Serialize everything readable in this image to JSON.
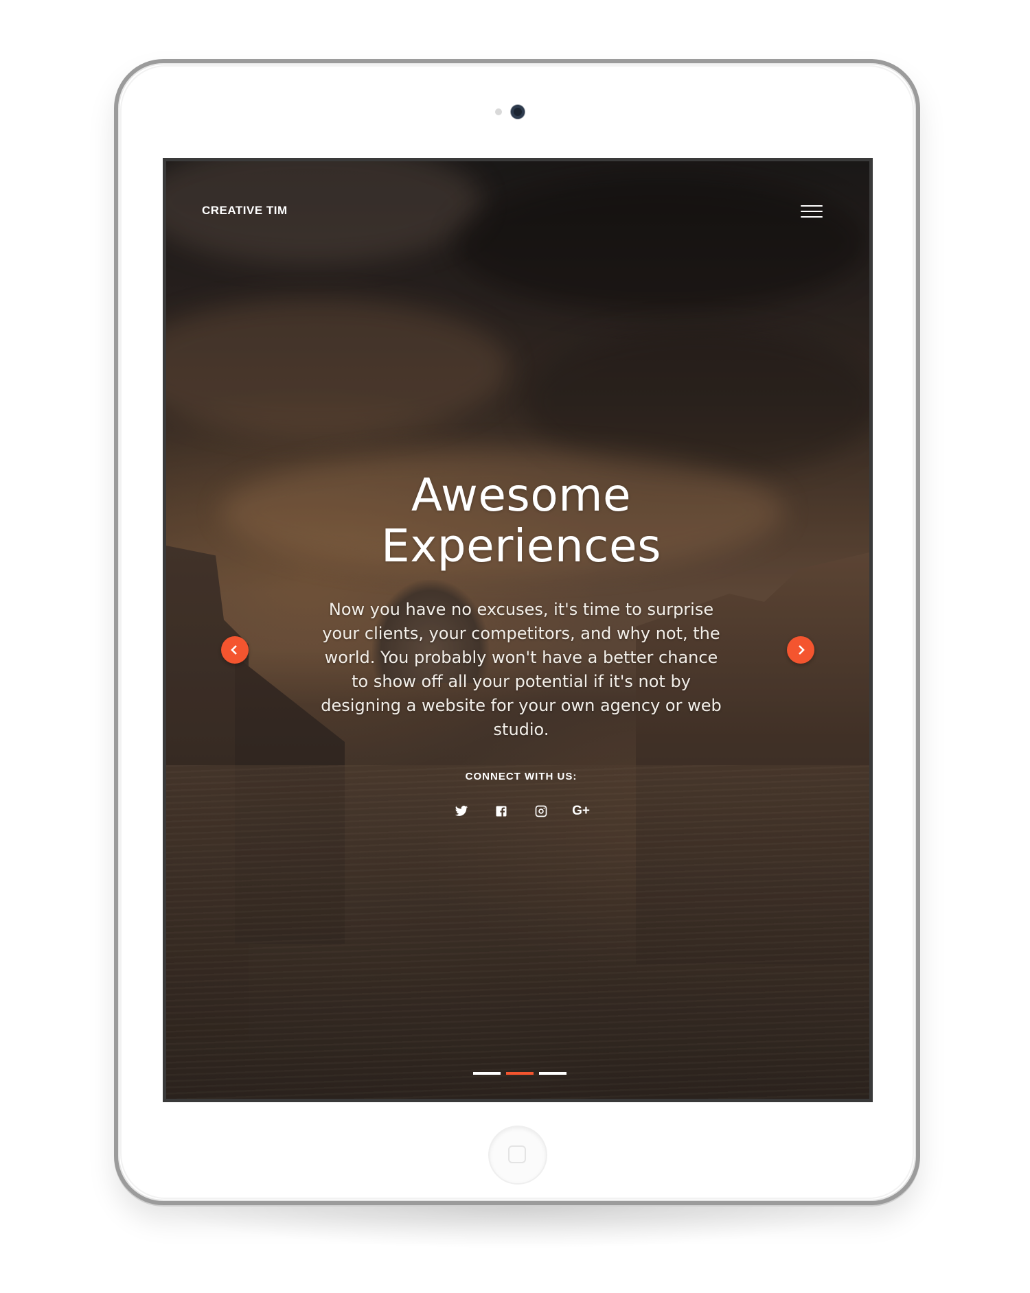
{
  "navbar": {
    "brand": "CREATIVE TIM",
    "menu_icon": "hamburger-menu-icon"
  },
  "hero": {
    "title_line1": "Awesome",
    "title_line2": "Experiences",
    "description": "Now you have no excuses, it's time to surprise your clients, your competitors, and why not, the world. You probably won't have a better chance to show off all your potential if it's not by designing a website for your own agency or web studio.",
    "connect_label": "CONNECT WITH US:",
    "social_links": [
      {
        "icon": "twitter-icon"
      },
      {
        "icon": "facebook-icon"
      },
      {
        "icon": "instagram-icon"
      },
      {
        "icon": "google-plus-icon",
        "text": "G+"
      }
    ]
  },
  "carousel": {
    "prev_icon": "chevron-left-icon",
    "next_icon": "chevron-right-icon",
    "slide_count": 3,
    "active_slide": 2
  },
  "colors": {
    "accent": "#f4552f",
    "text": "#ffffff",
    "device_frame": "#ffffff"
  }
}
